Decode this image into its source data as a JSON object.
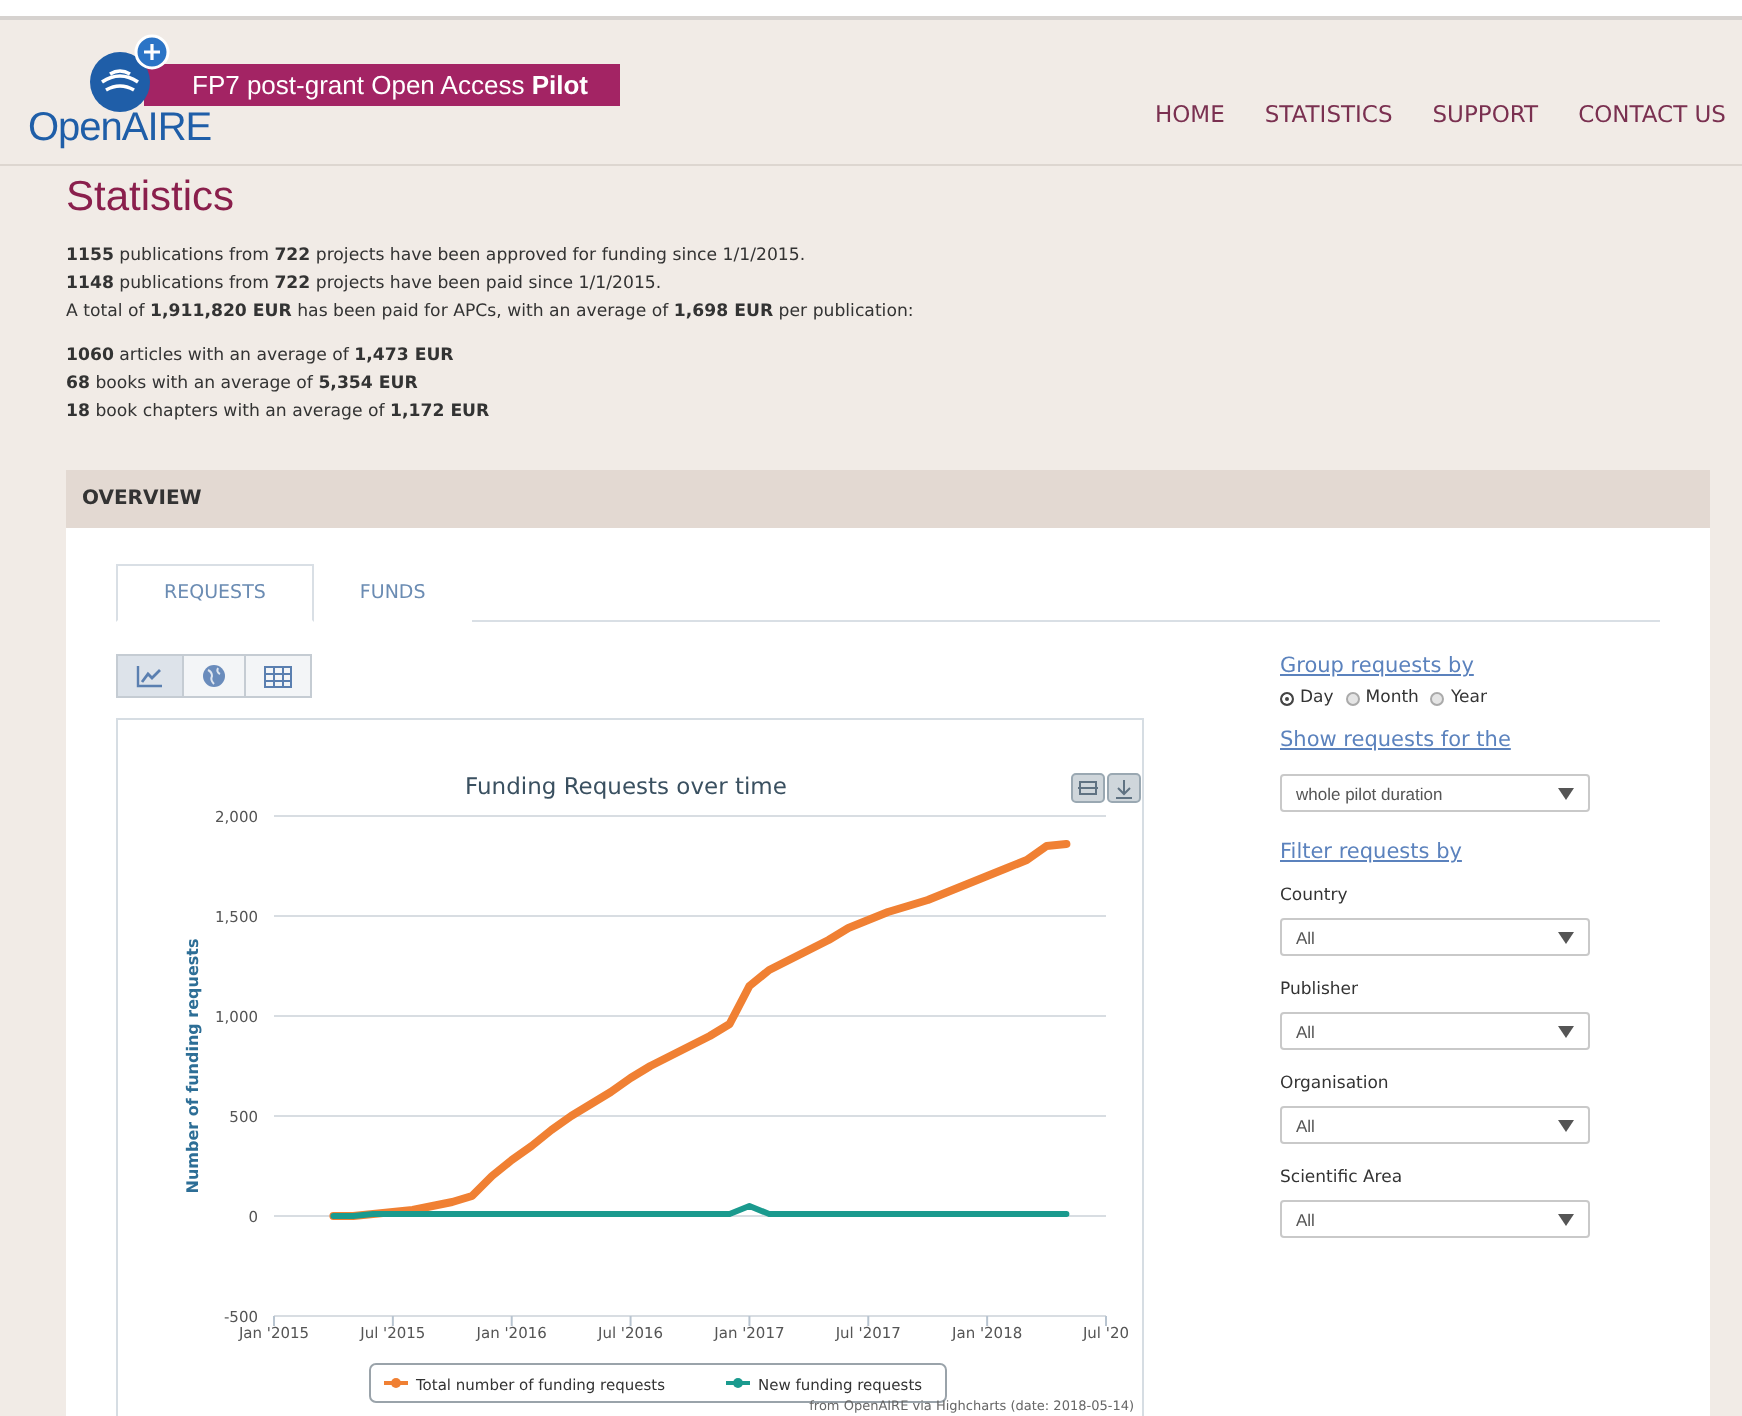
{
  "header": {
    "banner": "FP7 post-grant Open Access **Pilot**",
    "logo": "OpenAIRE",
    "nav": [
      {
        "label": "HOME",
        "selected": false
      },
      {
        "label": "STATISTICS",
        "selected": false
      },
      {
        "label": "SUPPORT",
        "selected": false
      },
      {
        "label": "CONTACT US",
        "selected": false
      }
    ]
  },
  "page_title": "Statistics",
  "summary": [
    "**1155** publications from **722** projects have been approved for funding since 1/1/2015.",
    "**1148** publications from **722** projects have been paid since 1/1/2015.",
    "A total of **1,911,820 EUR** has been paid for APCs, with an average of **1,698 EUR** per publication:"
  ],
  "breakdown": [
    "**1060** articles with an average of **1,473 EUR**",
    "**68** books with an average of **5,354 EUR**",
    "**18** book chapters with an average of **1,172 EUR**"
  ],
  "overview": {
    "heading": "OVERVIEW",
    "tabs": [
      {
        "label": "REQUESTS",
        "selected": true
      },
      {
        "label": "FUNDS",
        "selected": false
      }
    ],
    "views": [
      {
        "kind": "chart",
        "selected": true
      },
      {
        "kind": "map",
        "selected": false
      },
      {
        "kind": "table",
        "selected": false
      }
    ],
    "chart_data": {
      "type": "line",
      "title": "Funding Requests over time",
      "ylabel": "Number of funding requests",
      "categories": [
        "Jan '2015",
        null,
        null,
        null,
        null,
        null,
        "Jul '2015",
        null,
        null,
        null,
        null,
        null,
        "Jan '2016",
        null,
        null,
        null,
        null,
        null,
        "Jul '2016",
        null,
        null,
        null,
        null,
        null,
        "Jan '2017",
        null,
        null,
        null,
        null,
        null,
        "Jul '2017",
        null,
        null,
        null,
        null,
        null,
        "Jan '2018",
        null,
        null,
        null,
        null,
        null,
        "Jul '20"
      ],
      "ylim": [
        -500,
        2000
      ],
      "grid": true,
      "legend": "bottom",
      "yticks": [
        {
          "value": -500,
          "label": "-500"
        },
        {
          "value": 0,
          "label": "0"
        },
        {
          "value": 500,
          "label": "500"
        },
        {
          "value": 1000,
          "label": "1,000"
        },
        {
          "value": 1500,
          "label": "1,500"
        },
        {
          "value": 2000,
          "label": "2,000"
        }
      ],
      "series": [
        {
          "name": "Total number of funding requests",
          "color": "#f08033",
          "values": [
            null,
            null,
            null,
            0,
            0,
            10,
            20,
            30,
            50,
            70,
            100,
            200,
            280,
            350,
            430,
            500,
            560,
            620,
            690,
            750,
            800,
            850,
            900,
            960,
            1150,
            1230,
            1280,
            1330,
            1380,
            1440,
            1480,
            1520,
            1550,
            1580,
            1620,
            1660,
            1700,
            1740,
            1780,
            1850,
            1860,
            null,
            null
          ]
        },
        {
          "name": "New funding requests",
          "color": "#1a9a8e",
          "values": [
            null,
            null,
            null,
            0,
            0,
            10,
            10,
            10,
            10,
            10,
            10,
            10,
            10,
            10,
            10,
            10,
            10,
            10,
            10,
            10,
            10,
            10,
            10,
            10,
            50,
            10,
            10,
            10,
            10,
            10,
            10,
            10,
            10,
            10,
            10,
            10,
            10,
            10,
            10,
            10,
            10,
            null,
            null
          ]
        }
      ]
    },
    "credit": "from OpenAIRE via Highcharts (date: 2018-05-14)"
  },
  "filters": {
    "group_heading": "Group requests by",
    "group_options": [
      {
        "label": "Day",
        "selected": true
      },
      {
        "label": "Month",
        "selected": false
      },
      {
        "label": "Year",
        "selected": false
      }
    ],
    "period_heading": "Show requests for the",
    "period_value": "whole pilot duration",
    "filter_heading": "Filter requests by",
    "selects": [
      {
        "label": "Country",
        "value": "All"
      },
      {
        "label": "Publisher",
        "value": "All"
      },
      {
        "label": "Organisation",
        "value": "All"
      },
      {
        "label": "Scientific Area",
        "value": "All"
      }
    ]
  }
}
